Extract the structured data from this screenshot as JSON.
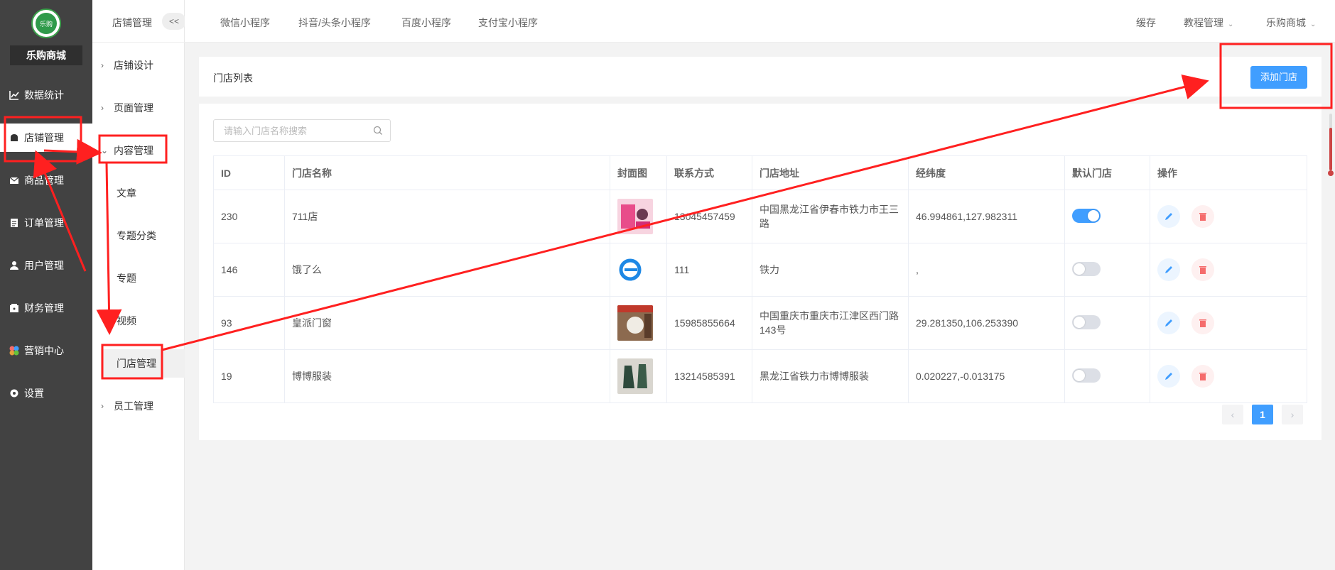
{
  "sidebar": {
    "brand": "乐购商城",
    "logo_text": "乐购",
    "items": [
      {
        "label": "数据统计",
        "icon": "chart-icon"
      },
      {
        "label": "店铺管理",
        "icon": "store-icon"
      },
      {
        "label": "商品管理",
        "icon": "mail-icon"
      },
      {
        "label": "订单管理",
        "icon": "order-icon"
      },
      {
        "label": "用户管理",
        "icon": "user-icon"
      },
      {
        "label": "财务管理",
        "icon": "wallet-icon"
      },
      {
        "label": "营销中心",
        "icon": "marketing-icon"
      },
      {
        "label": "设置",
        "icon": "gear-icon"
      }
    ]
  },
  "submenu": {
    "title": "店铺管理",
    "collapse": "<<",
    "items": [
      {
        "label": "店铺设计"
      },
      {
        "label": "页面管理"
      },
      {
        "label": "内容管理"
      },
      {
        "label": "文章"
      },
      {
        "label": "专题分类"
      },
      {
        "label": "专题"
      },
      {
        "label": "视频"
      },
      {
        "label": "门店管理"
      },
      {
        "label": "员工管理"
      }
    ]
  },
  "topnav": {
    "tabs": [
      "微信小程序",
      "抖音/头条小程序",
      "百度小程序",
      "支付宝小程序"
    ],
    "right": {
      "cache": "缓存",
      "tutorial": "教程管理",
      "shop": "乐购商城"
    }
  },
  "page": {
    "title": "门店列表",
    "add_button": "添加门店",
    "search_placeholder": "请输入门店名称搜索"
  },
  "table": {
    "headers": [
      "ID",
      "门店名称",
      "封面图",
      "联系方式",
      "门店地址",
      "经纬度",
      "默认门店",
      "操作"
    ],
    "rows": [
      {
        "id": "230",
        "name": "711店",
        "phone": "13045457459",
        "address": "中国黑龙江省伊春市铁力市王三路",
        "latlng": "46.994861,127.982311",
        "default": true
      },
      {
        "id": "146",
        "name": "饿了么",
        "phone": "111",
        "address": "铁力",
        "latlng": ",",
        "default": false
      },
      {
        "id": "93",
        "name": "皇派门窗",
        "phone": "15985855664",
        "address": "中国重庆市重庆市江津区西门路143号",
        "latlng": "29.281350,106.253390",
        "default": false
      },
      {
        "id": "19",
        "name": "博博服装",
        "phone": "13214585391",
        "address": "黑龙江省铁力市博博服装",
        "latlng": "0.020227,-0.013175",
        "default": false
      }
    ]
  },
  "pagination": {
    "prev": "‹",
    "current": "1",
    "next": "›"
  },
  "colors": {
    "accent": "#409eff",
    "sidebar_bg": "#424242",
    "annotation": "#ff2020",
    "danger": "#f56c6c"
  }
}
